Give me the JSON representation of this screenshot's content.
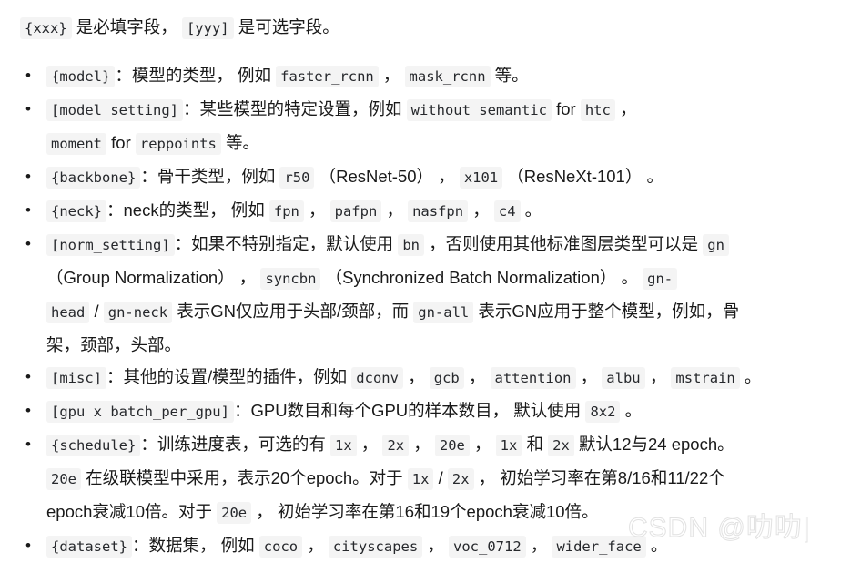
{
  "intro": {
    "required_token": "{xxx}",
    "required_text": " 是必填字段，  ",
    "optional_token": "[yyy]",
    "optional_text": " 是可选字段。"
  },
  "bullet_marker": "•",
  "items": [
    {
      "name": "model",
      "lines": [
        [
          {
            "t": "code",
            "v": "{model}"
          },
          {
            "t": "text",
            "v": "：模型的类型，  例如 "
          },
          {
            "t": "code",
            "v": "faster_rcnn"
          },
          {
            "t": "text",
            "v": " ，  "
          },
          {
            "t": "code",
            "v": "mask_rcnn"
          },
          {
            "t": "text",
            "v": " 等。"
          }
        ]
      ]
    },
    {
      "name": "model-setting",
      "lines": [
        [
          {
            "t": "code",
            "v": "[model setting]"
          },
          {
            "t": "text",
            "v": "：某些模型的特定设置，例如 "
          },
          {
            "t": "code",
            "v": "without_semantic"
          },
          {
            "t": "text",
            "v": " for "
          },
          {
            "t": "code",
            "v": "htc"
          },
          {
            "t": "text",
            "v": " ，"
          }
        ],
        [
          {
            "t": "code",
            "v": "moment"
          },
          {
            "t": "text",
            "v": " for "
          },
          {
            "t": "code",
            "v": "reppoints"
          },
          {
            "t": "text",
            "v": " 等。"
          }
        ]
      ]
    },
    {
      "name": "backbone",
      "lines": [
        [
          {
            "t": "code",
            "v": "{backbone}"
          },
          {
            "t": "text",
            "v": "：骨干类型，例如 "
          },
          {
            "t": "code",
            "v": "r50"
          },
          {
            "t": "text",
            "v": " （ResNet-50） ，  "
          },
          {
            "t": "code",
            "v": "x101"
          },
          {
            "t": "text",
            "v": " （ResNeXt-101） 。"
          }
        ]
      ]
    },
    {
      "name": "neck",
      "lines": [
        [
          {
            "t": "code",
            "v": "{neck}"
          },
          {
            "t": "text",
            "v": "：neck的类型，  例如 "
          },
          {
            "t": "code",
            "v": "fpn"
          },
          {
            "t": "text",
            "v": " ，  "
          },
          {
            "t": "code",
            "v": "pafpn"
          },
          {
            "t": "text",
            "v": " ，  "
          },
          {
            "t": "code",
            "v": "nasfpn"
          },
          {
            "t": "text",
            "v": " ，  "
          },
          {
            "t": "code",
            "v": "c4"
          },
          {
            "t": "text",
            "v": " 。"
          }
        ]
      ]
    },
    {
      "name": "norm-setting",
      "lines": [
        [
          {
            "t": "code",
            "v": "[norm_setting]"
          },
          {
            "t": "text",
            "v": "：如果不特别指定，默认使用 "
          },
          {
            "t": "code",
            "v": "bn"
          },
          {
            "t": "text",
            "v": " ，否则使用其他标准图层类型可以是 "
          },
          {
            "t": "code",
            "v": "gn"
          }
        ],
        [
          {
            "t": "text",
            "v": "（Group Normalization） ，  "
          },
          {
            "t": "code",
            "v": "syncbn"
          },
          {
            "t": "text",
            "v": " （Synchronized Batch Normalization） 。   "
          },
          {
            "t": "code",
            "v": "gn-"
          }
        ],
        [
          {
            "t": "code",
            "v": "head"
          },
          {
            "t": "text",
            "v": " / "
          },
          {
            "t": "code",
            "v": "gn-neck"
          },
          {
            "t": "text",
            "v": " 表示GN仅应用于头部/颈部，而 "
          },
          {
            "t": "code",
            "v": "gn-all"
          },
          {
            "t": "text",
            "v": " 表示GN应用于整个模型，例如，骨"
          }
        ],
        [
          {
            "t": "text",
            "v": "架，颈部，头部。"
          }
        ]
      ]
    },
    {
      "name": "misc",
      "lines": [
        [
          {
            "t": "code",
            "v": "[misc]"
          },
          {
            "t": "text",
            "v": "：其他的设置/模型的插件，例如 "
          },
          {
            "t": "code",
            "v": "dconv"
          },
          {
            "t": "text",
            "v": " ，  "
          },
          {
            "t": "code",
            "v": "gcb"
          },
          {
            "t": "text",
            "v": " ，  "
          },
          {
            "t": "code",
            "v": "attention"
          },
          {
            "t": "text",
            "v": " ，  "
          },
          {
            "t": "code",
            "v": "albu"
          },
          {
            "t": "text",
            "v": " ，  "
          },
          {
            "t": "code",
            "v": "mstrain"
          },
          {
            "t": "text",
            "v": " 。"
          }
        ]
      ]
    },
    {
      "name": "gpu-batch-per-gpu",
      "lines": [
        [
          {
            "t": "code",
            "v": "[gpu x batch_per_gpu]"
          },
          {
            "t": "text",
            "v": "：GPU数目和每个GPU的样本数目，  默认使用 "
          },
          {
            "t": "code",
            "v": "8x2"
          },
          {
            "t": "text",
            "v": " 。"
          }
        ]
      ]
    },
    {
      "name": "schedule",
      "lines": [
        [
          {
            "t": "code",
            "v": "{schedule}"
          },
          {
            "t": "text",
            "v": "：训练进度表，可选的有 "
          },
          {
            "t": "code",
            "v": "1x"
          },
          {
            "t": "text",
            "v": " ，  "
          },
          {
            "t": "code",
            "v": "2x"
          },
          {
            "t": "text",
            "v": " ，  "
          },
          {
            "t": "code",
            "v": "20e"
          },
          {
            "t": "text",
            "v": " ，   "
          },
          {
            "t": "code",
            "v": "1x"
          },
          {
            "t": "text",
            "v": " 和 "
          },
          {
            "t": "code",
            "v": "2x"
          },
          {
            "t": "text",
            "v": " 默认12与24 epoch。"
          }
        ],
        [
          {
            "t": "code",
            "v": "20e"
          },
          {
            "t": "text",
            "v": " 在级联模型中采用，表示20个epoch。对于 "
          },
          {
            "t": "code",
            "v": "1x"
          },
          {
            "t": "text",
            "v": " / "
          },
          {
            "t": "code",
            "v": "2x"
          },
          {
            "t": "text",
            "v": " ，  初始学习率在第8/16和11/22个"
          }
        ],
        [
          {
            "t": "text",
            "v": "epoch衰减10倍。对于 "
          },
          {
            "t": "code",
            "v": "20e"
          },
          {
            "t": "text",
            "v": " ，  初始学习率在第16和19个epoch衰减10倍。"
          }
        ]
      ]
    },
    {
      "name": "dataset",
      "lines": [
        [
          {
            "t": "code",
            "v": "{dataset}"
          },
          {
            "t": "text",
            "v": "：数据集，  例如 "
          },
          {
            "t": "code",
            "v": "coco"
          },
          {
            "t": "text",
            "v": " ，  "
          },
          {
            "t": "code",
            "v": "cityscapes"
          },
          {
            "t": "text",
            "v": " ，  "
          },
          {
            "t": "code",
            "v": "voc_0712"
          },
          {
            "t": "text",
            "v": " ，  "
          },
          {
            "t": "code",
            "v": "wider_face"
          },
          {
            "t": "text",
            "v": " 。"
          }
        ]
      ]
    }
  ],
  "watermark": {
    "site": "CSDN",
    "handle": "@叻叻|"
  },
  "colors": {
    "page_background": "#ffffff",
    "text": "#1a1a1a",
    "code_background": "#f4f4f4",
    "code_text": "#26282c",
    "watermark": "#e2e2e2"
  }
}
